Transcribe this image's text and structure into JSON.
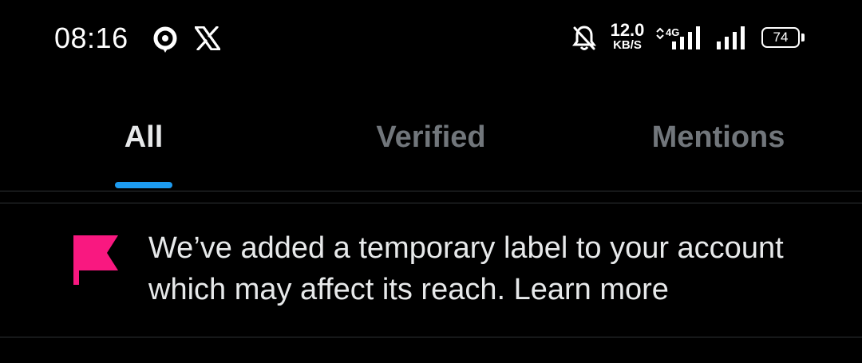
{
  "status_bar": {
    "time": "08:16",
    "icons": [
      "location-target-icon",
      "x-logo-icon",
      "bell-off-icon",
      "signal-4g-icon",
      "signal-icon"
    ],
    "network_speed": {
      "value": "12.0",
      "unit": "KB/S"
    },
    "network_type": "4G",
    "battery_level": "74"
  },
  "tabs": [
    {
      "label": "All",
      "selected": true
    },
    {
      "label": "Verified",
      "selected": false
    },
    {
      "label": "Mentions",
      "selected": false
    }
  ],
  "notice": {
    "icon": "flag-icon",
    "icon_color": "#f91880",
    "text": "We’ve added a temporary label to your account which may affect its reach. Learn more"
  },
  "colors": {
    "background": "#000000",
    "accent": "#1d9bf0",
    "text_primary": "#e7e9ea",
    "text_secondary": "#71767b",
    "divider": "#2f3336"
  }
}
